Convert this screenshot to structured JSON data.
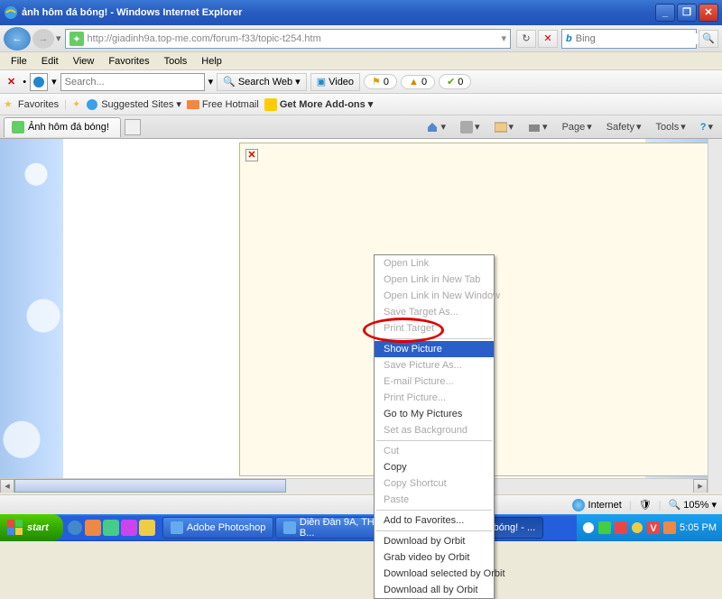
{
  "window": {
    "title": "ảnh hôm đá bóng! - Windows Internet Explorer"
  },
  "nav": {
    "url": "http://giadinh9a.top-me.com/forum-f33/topic-t254.htm",
    "search_engine": "Bing",
    "search_placeholder": "Bing"
  },
  "menu": [
    "File",
    "Edit",
    "View",
    "Favorites",
    "Tools",
    "Help"
  ],
  "toolbar1": {
    "search_placeholder": "Search...",
    "search_web": "Search Web",
    "video": "Video",
    "badge_yellow": "0",
    "badge_orange": "0",
    "badge_green": "0"
  },
  "favbar": {
    "favorites": "Favorites",
    "suggested": "Suggested Sites",
    "hotmail": "Free Hotmail",
    "addons": "Get More Add-ons"
  },
  "tab": {
    "title": "Ảnh hôm đá bóng!"
  },
  "cmdbar": {
    "page": "Page",
    "safety": "Safety",
    "tools": "Tools"
  },
  "context_menu": [
    {
      "t": "Open Link",
      "d": true
    },
    {
      "t": "Open Link in New Tab",
      "d": true
    },
    {
      "t": "Open Link in New Window",
      "d": true
    },
    {
      "t": "Save Target As...",
      "d": true
    },
    {
      "t": "Print Target",
      "d": true
    },
    {
      "sep": true
    },
    {
      "t": "Show Picture",
      "hl": true
    },
    {
      "t": "Save Picture As...",
      "d": true
    },
    {
      "t": "E-mail Picture...",
      "d": true
    },
    {
      "t": "Print Picture...",
      "d": true
    },
    {
      "t": "Go to My Pictures",
      "d": false
    },
    {
      "t": "Set as Background",
      "d": true
    },
    {
      "sep": true
    },
    {
      "t": "Cut",
      "d": true
    },
    {
      "t": "Copy",
      "d": false
    },
    {
      "t": "Copy Shortcut",
      "d": true
    },
    {
      "t": "Paste",
      "d": true
    },
    {
      "sep": true
    },
    {
      "t": "Add to Favorites...",
      "d": false
    },
    {
      "sep": true
    },
    {
      "t": "Download by Orbit",
      "d": false
    },
    {
      "t": "Grab video by Orbit",
      "d": false
    },
    {
      "t": "Download selected by Orbit",
      "d": false
    },
    {
      "t": "Download all by Orbit",
      "d": false
    }
  ],
  "status": {
    "zone": "Internet",
    "zoom": "105%"
  },
  "taskbar": {
    "start": "start",
    "tasks": [
      {
        "label": "Adobe Photoshop",
        "active": false
      },
      {
        "label": "Diễn Đàn 9A, THCS B...",
        "active": false
      },
      {
        "label": "Ảnh hôm đá bóng! - ...",
        "active": true
      }
    ],
    "clock": "5:05 PM"
  }
}
